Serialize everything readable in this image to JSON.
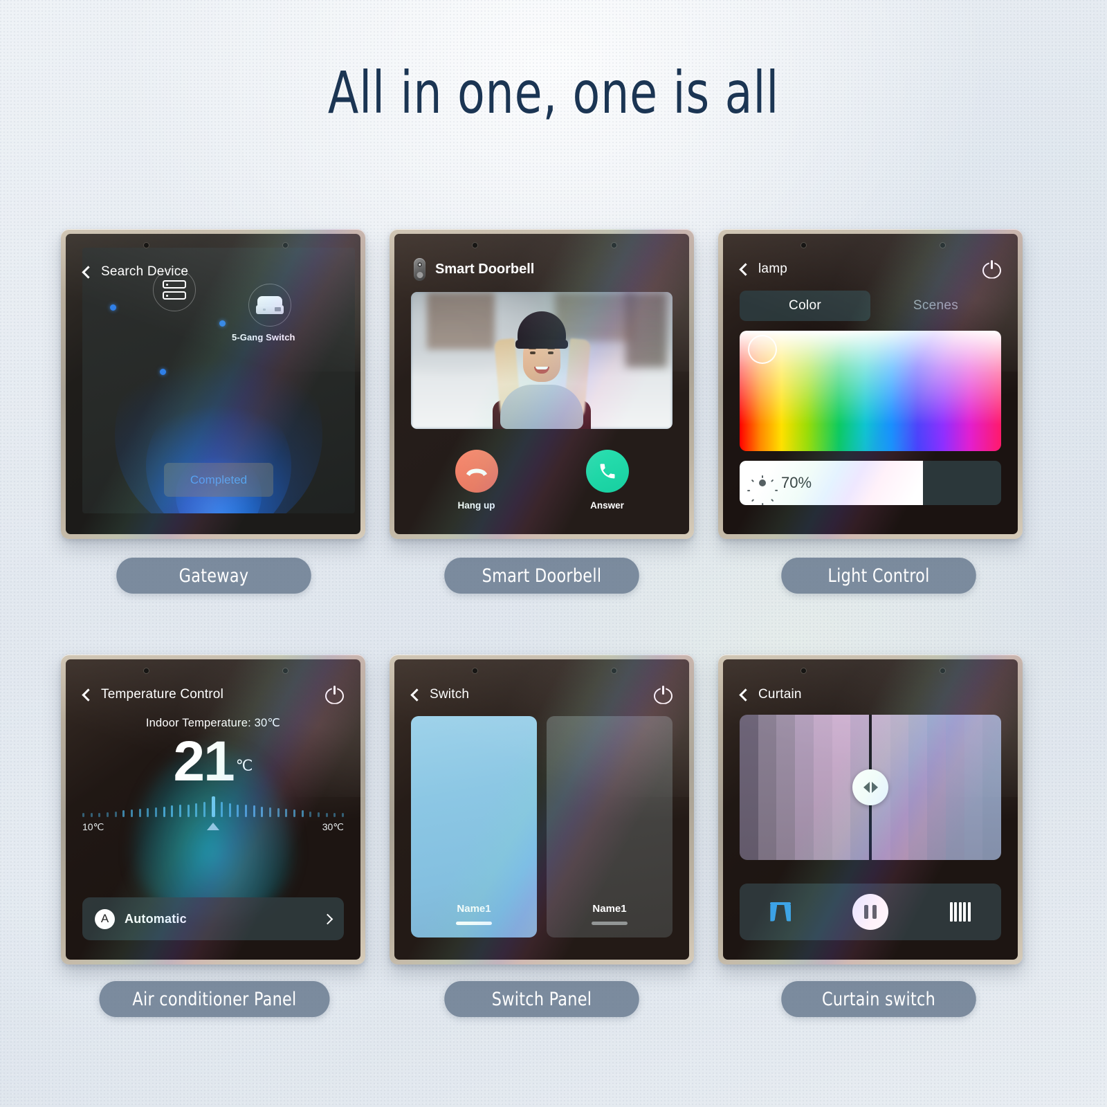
{
  "headline": "All in one, one is all",
  "panels": [
    {
      "caption": "Gateway",
      "header_title": "Search Device",
      "device_name": "5-Gang Switch",
      "action_label": "Completed"
    },
    {
      "caption": "Smart Doorbell",
      "header_title": "Smart Doorbell",
      "hangup_label": "Hang up",
      "answer_label": "Answer"
    },
    {
      "caption": "Light Control",
      "header_title": "lamp",
      "tabs": [
        {
          "label": "Color",
          "active": true
        },
        {
          "label": "Scenes",
          "active": false
        }
      ],
      "brightness_label": "70%",
      "brightness_value": 70
    },
    {
      "caption": "Air conditioner Panel",
      "header_title": "Temperature Control",
      "indoor_line": "Indoor Temperature: 30℃",
      "set_temp": "21",
      "set_unit": "℃",
      "range_min": "10℃",
      "range_max": "30℃",
      "mode_badge": "A",
      "mode_label": "Automatic"
    },
    {
      "caption": "Switch Panel",
      "header_title": "Switch",
      "switches": [
        {
          "name": "Name1",
          "state": "on"
        },
        {
          "name": "Name1",
          "state": "off"
        }
      ]
    },
    {
      "caption": "Curtain switch",
      "header_title": "Curtain"
    }
  ],
  "colors": {
    "headline": "#1b3553",
    "caption_pill": "#6a7c90",
    "accent_blue": "#4ea7ef",
    "hangup_red": "#f26a55",
    "answer_green": "#17cfa0",
    "switch_on_blue": "#8cc7e4",
    "curtain_icon_blue": "#3aa0e8",
    "wall": "#e4e9ef"
  }
}
